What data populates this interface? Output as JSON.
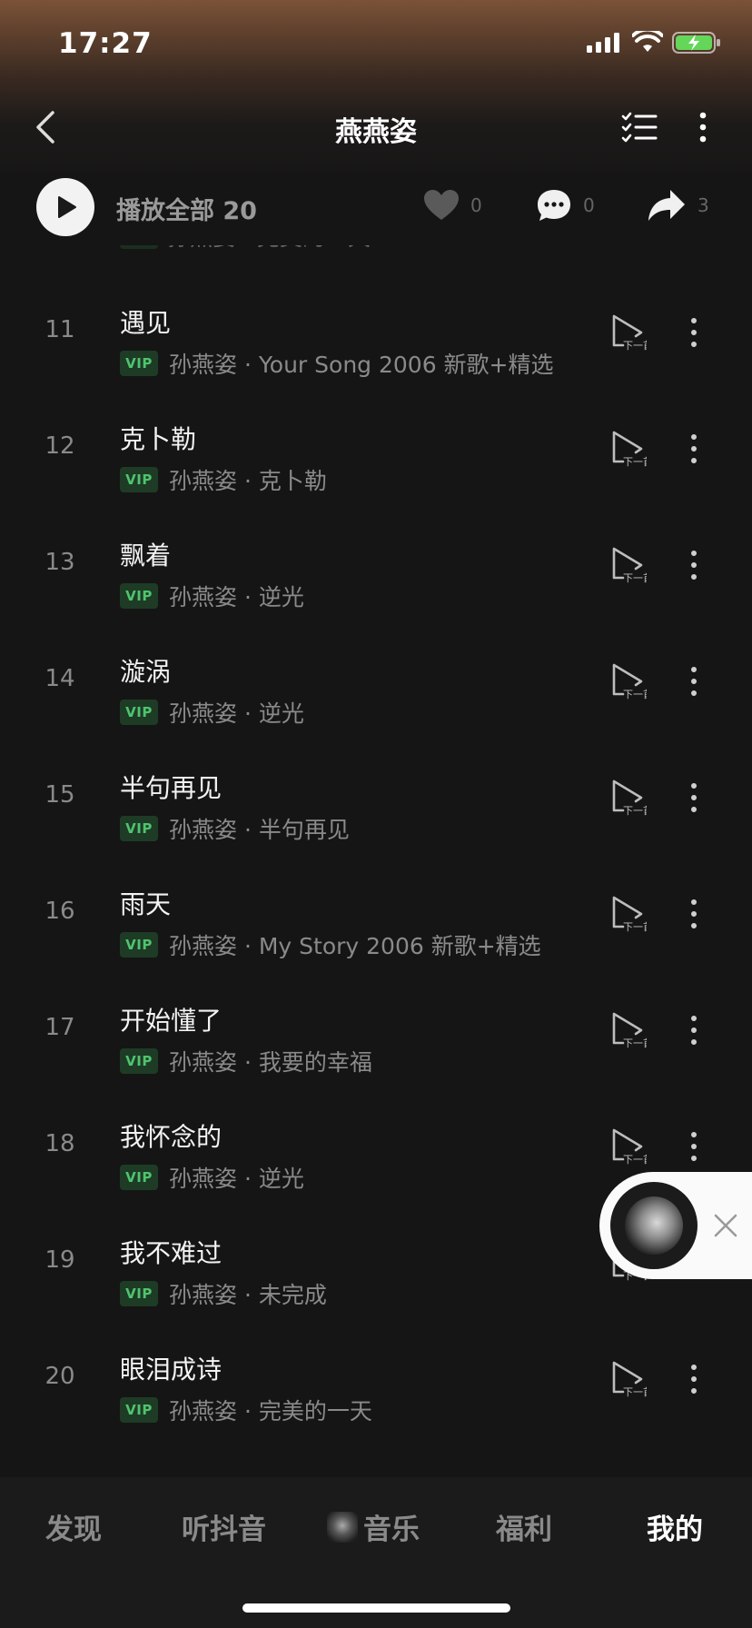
{
  "status_bar": {
    "time": "17:27"
  },
  "header": {
    "title": "燕燕姿"
  },
  "action_bar": {
    "play_all_label": "播放全部 20",
    "likes_count": "0",
    "comments_count": "0",
    "shares_count": "3"
  },
  "partial_row": {
    "vip": "VIP",
    "artist_album": "孙燕姿 · 完美的一天"
  },
  "songs": [
    {
      "index": "11",
      "title": "遇见",
      "vip": "VIP",
      "artist_album": "孙燕姿 · Your Song 2006 新歌+精选"
    },
    {
      "index": "12",
      "title": "克卜勒",
      "vip": "VIP",
      "artist_album": "孙燕姿 · 克卜勒"
    },
    {
      "index": "13",
      "title": "飘着",
      "vip": "VIP",
      "artist_album": "孙燕姿 · 逆光"
    },
    {
      "index": "14",
      "title": "漩涡",
      "vip": "VIP",
      "artist_album": "孙燕姿 · 逆光"
    },
    {
      "index": "15",
      "title": "半句再见",
      "vip": "VIP",
      "artist_album": "孙燕姿 · 半句再见"
    },
    {
      "index": "16",
      "title": "雨天",
      "vip": "VIP",
      "artist_album": "孙燕姿 · My Story 2006 新歌+精选"
    },
    {
      "index": "17",
      "title": "开始懂了",
      "vip": "VIP",
      "artist_album": "孙燕姿 · 我要的幸福"
    },
    {
      "index": "18",
      "title": "我怀念的",
      "vip": "VIP",
      "artist_album": "孙燕姿 · 逆光"
    },
    {
      "index": "19",
      "title": "我不难过",
      "vip": "VIP",
      "artist_album": "孙燕姿 · 未完成"
    },
    {
      "index": "20",
      "title": "眼泪成诗",
      "vip": "VIP",
      "artist_album": "孙燕姿 · 完美的一天"
    }
  ],
  "next_icon_label": "下一首",
  "tabbar": {
    "discover": "发现",
    "douyin": "听抖音",
    "music": "音乐",
    "welfare": "福利",
    "mine": "我的"
  },
  "colors": {
    "accent_vip": "#4fc46e",
    "background": "#151515"
  }
}
